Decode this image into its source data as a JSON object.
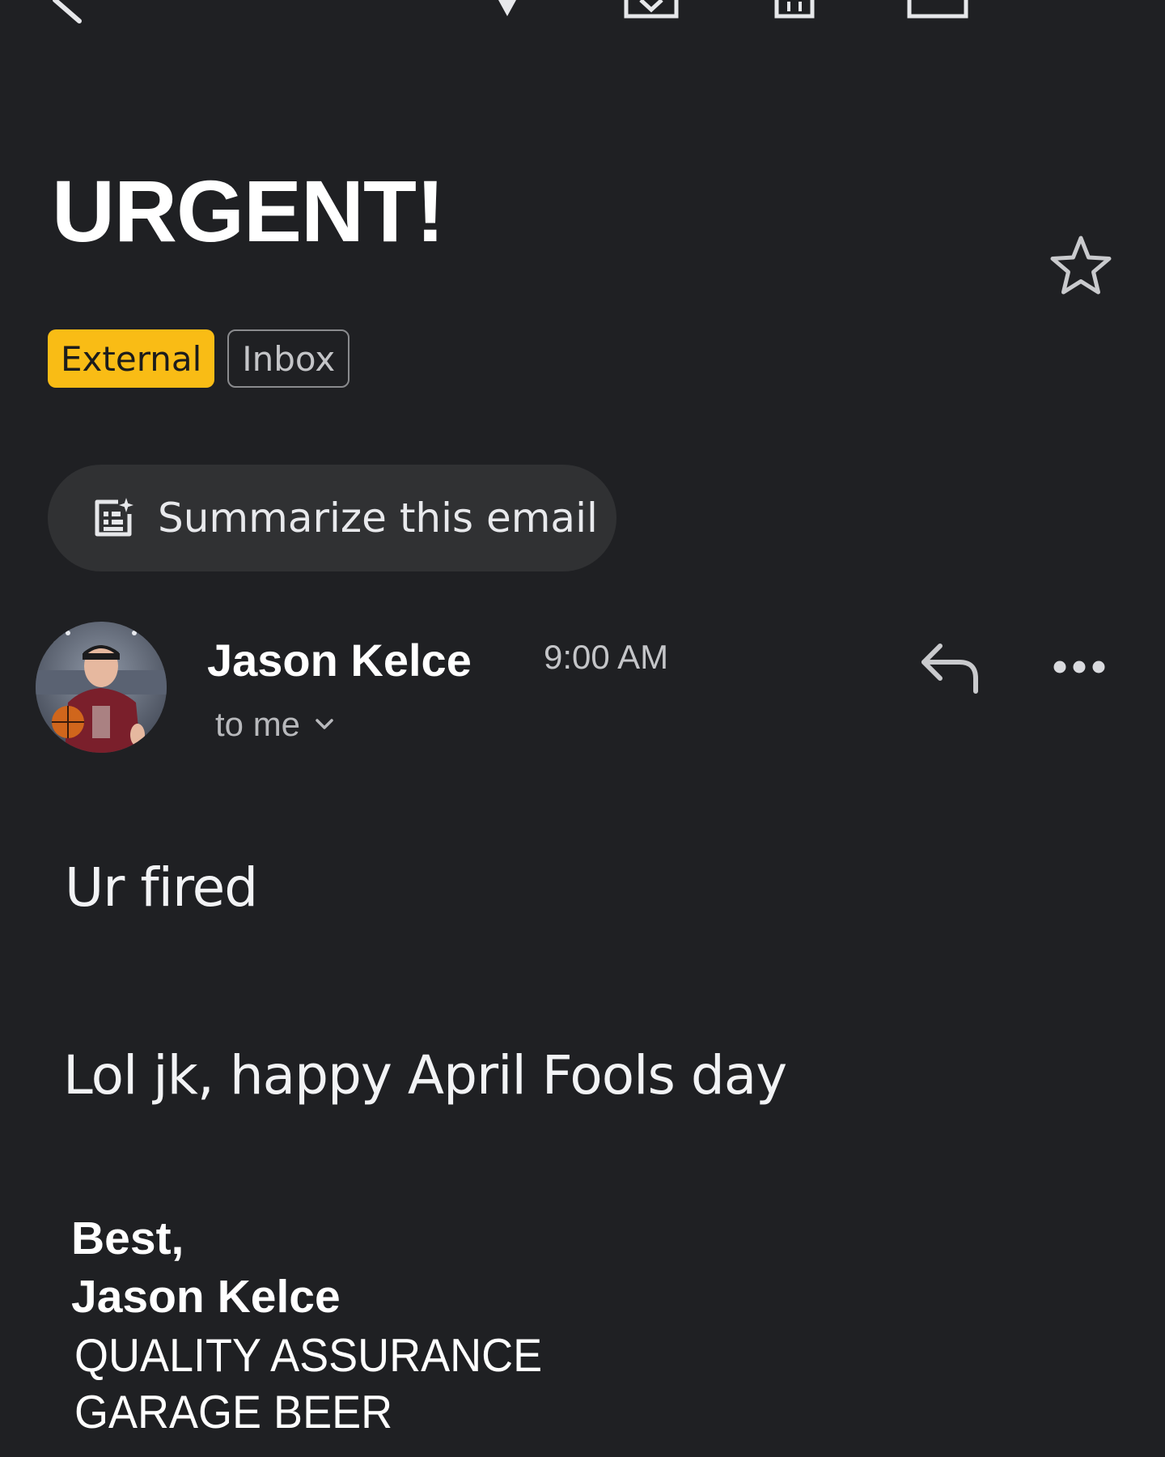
{
  "email": {
    "subject": "URGENT!",
    "labels": [
      "External",
      "Inbox"
    ],
    "summarize_label": "Summarize this email",
    "sender": "Jason Kelce",
    "time": "9:00 AM",
    "recipient": "to me",
    "body": [
      "Ur fired",
      "Lol jk, happy April Fools day"
    ],
    "signature": {
      "closing": "Best,",
      "name": "Jason Kelce",
      "title": "QUALITY ASSURANCE",
      "company": "GARAGE BEER"
    }
  },
  "icons": {
    "toolbar": [
      "back-arrow-icon",
      "dropdown-icon",
      "archive-icon",
      "delete-icon",
      "mail-icon"
    ],
    "star": "star-icon",
    "summarize": "summary-sparkle-icon",
    "reply": "reply-icon",
    "more": "more-horizontal-icon",
    "recipient_toggle": "chevron-down-icon"
  },
  "colors": {
    "background": "#1f2023",
    "external_chip": "#f9bc15",
    "summarize_pill": "#303133"
  }
}
